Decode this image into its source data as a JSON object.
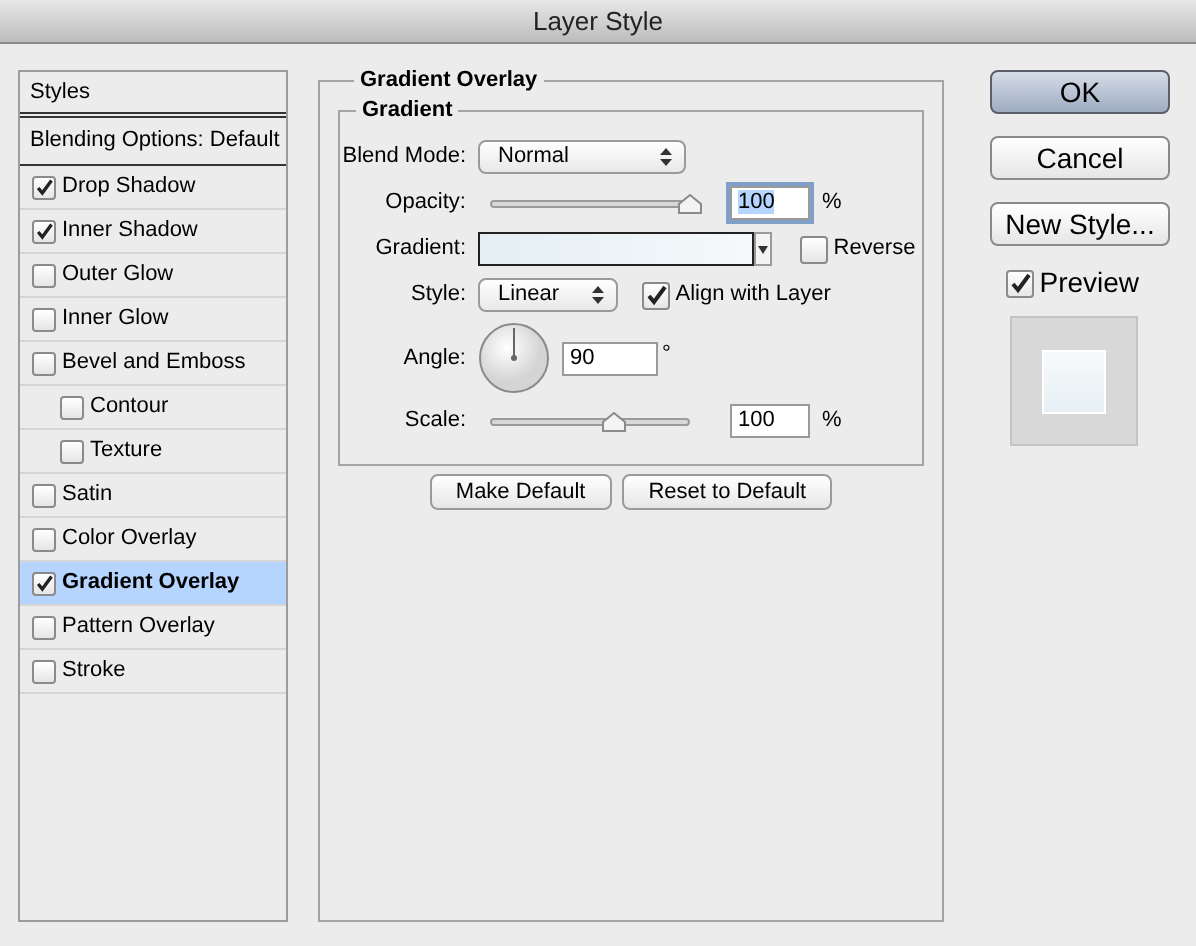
{
  "window": {
    "title": "Layer Style"
  },
  "styles_panel": {
    "header": "Styles",
    "blending_options": "Blending Options: Default",
    "items": [
      {
        "label": "Drop Shadow",
        "checked": true,
        "selected": false
      },
      {
        "label": "Inner Shadow",
        "checked": true,
        "selected": false
      },
      {
        "label": "Outer Glow",
        "checked": false,
        "selected": false
      },
      {
        "label": "Inner Glow",
        "checked": false,
        "selected": false
      },
      {
        "label": "Bevel and Emboss",
        "checked": false,
        "selected": false,
        "children": [
          {
            "label": "Contour",
            "checked": false,
            "selected": false
          },
          {
            "label": "Texture",
            "checked": false,
            "selected": false
          }
        ]
      },
      {
        "label": "Satin",
        "checked": false,
        "selected": false
      },
      {
        "label": "Color Overlay",
        "checked": false,
        "selected": false
      },
      {
        "label": "Gradient Overlay",
        "checked": true,
        "selected": true
      },
      {
        "label": "Pattern Overlay",
        "checked": false,
        "selected": false
      },
      {
        "label": "Stroke",
        "checked": false,
        "selected": false
      }
    ]
  },
  "section": {
    "title": "Gradient Overlay",
    "group_title": "Gradient",
    "blend_mode": {
      "label": "Blend Mode:",
      "value": "Normal"
    },
    "opacity": {
      "label": "Opacity:",
      "level": 1,
      "value": "100",
      "unit": "%",
      "focused": true
    },
    "gradient": {
      "label": "Gradient:"
    },
    "reverse": {
      "label": "Reverse",
      "checked": false
    },
    "style": {
      "label": "Style:",
      "value": "Linear"
    },
    "align_with_layer": {
      "label": "Align with Layer",
      "checked": true
    },
    "angle": {
      "label": "Angle:",
      "value": "90",
      "unit": "°"
    },
    "scale": {
      "label": "Scale:",
      "level": 0.62,
      "value": "100",
      "unit": "%",
      "focused": false
    },
    "buttons": [
      "Make Default",
      "Reset to Default"
    ]
  },
  "actions": [
    {
      "label": "OK",
      "default": true
    },
    {
      "label": "Cancel",
      "default": false
    },
    {
      "label": "New Style...",
      "default": false
    }
  ],
  "preview": {
    "label": "Preview",
    "checked": true
  }
}
